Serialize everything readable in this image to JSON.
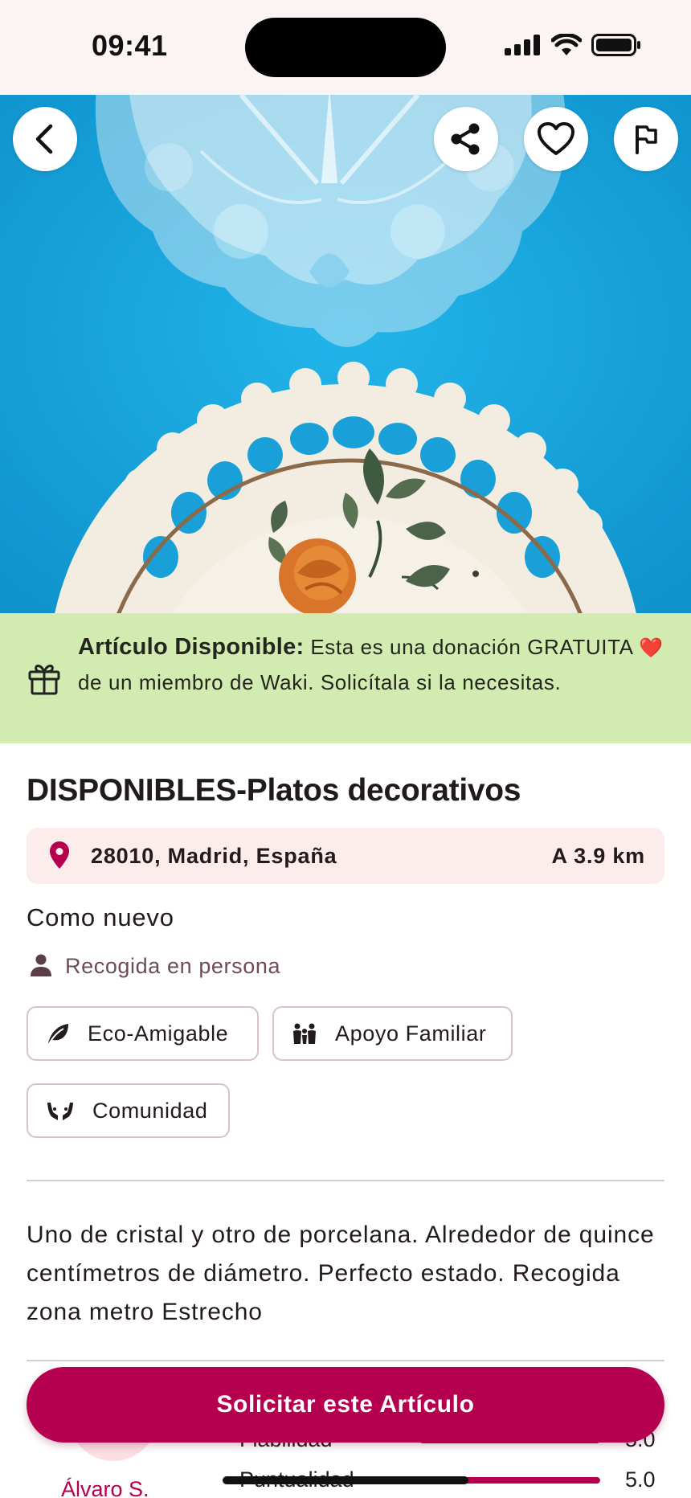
{
  "status_bar": {
    "time": "09:41"
  },
  "hero": {
    "back_icon": "chevron-left-icon",
    "share_icon": "share-icon",
    "favorite_icon": "heart-icon",
    "report_icon": "flag-icon"
  },
  "banner": {
    "icon": "gift-icon",
    "bold": "Artículo Disponible:",
    "text_1": " Esta es una donación GRATUITA ",
    "emoji": "❤️",
    "text_2": "  de un miembro de Waki. Solicítala si la necesitas."
  },
  "item": {
    "title": "DISPONIBLES-Platos decorativos",
    "location": "28010, Madrid, España",
    "distance": "A 3.9 km",
    "condition": "Como nuevo",
    "pickup": "Recogida en persona",
    "tags": [
      {
        "label": "Eco-Amigable",
        "icon": "leaf-icon"
      },
      {
        "label": "Apoyo Familiar",
        "icon": "family-icon"
      },
      {
        "label": "Comunidad",
        "icon": "hands-icon"
      }
    ],
    "description": "Uno de cristal y otro de porcelana. Alrededor de quince centímetros de diámetro. Perfecto estado. Recogida zona metro Estrecho"
  },
  "donor": {
    "initials": "ÁS",
    "name": "Álvaro S.",
    "metrics": [
      {
        "label": "Fiabilidad",
        "value": "5.0",
        "level": 1.0
      },
      {
        "label": "Puntualidad",
        "value": "5.0",
        "level": 1.0
      }
    ]
  },
  "cta": {
    "label": "Solicitar este Artículo"
  },
  "colors": {
    "accent": "#b5004f",
    "banner": "#d2ebb0",
    "location_card": "#fcecec",
    "hero_background": "#1aa7de"
  }
}
